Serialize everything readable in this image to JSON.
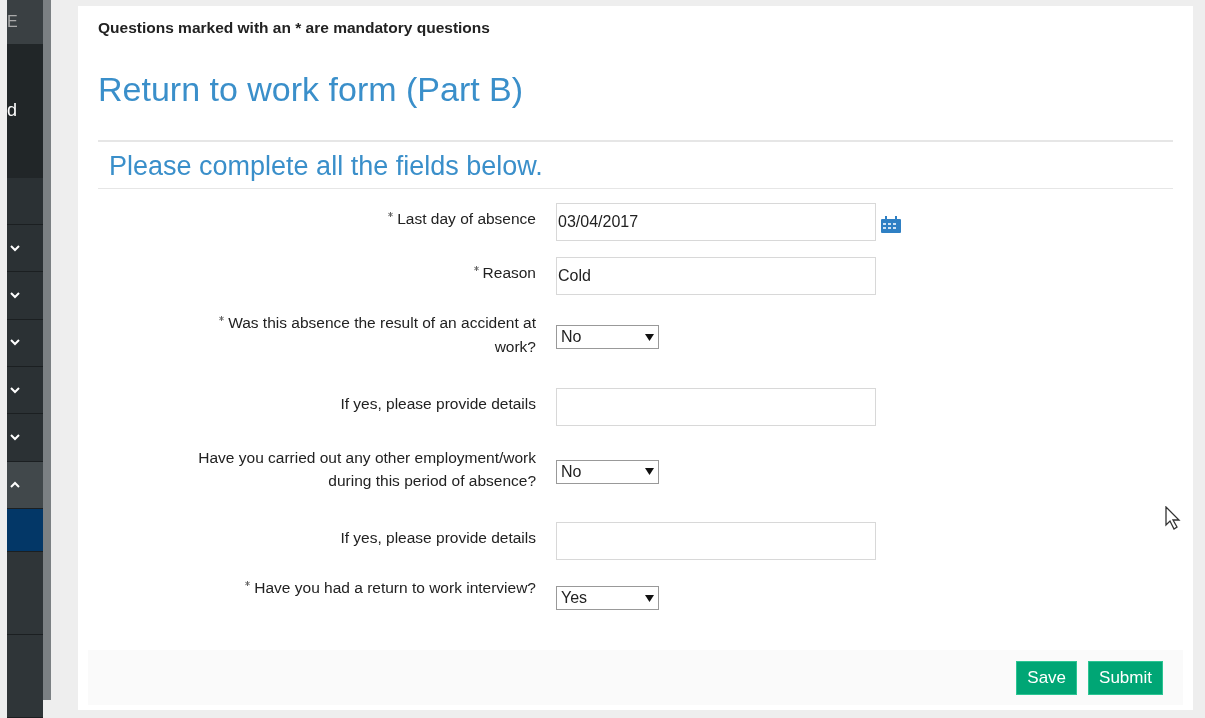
{
  "sidebar": {
    "header": "E",
    "title": "d",
    "items": [
      {
        "kind": "plain",
        "selected": false
      },
      {
        "kind": "group",
        "expanded": false,
        "selected": false
      },
      {
        "kind": "group",
        "expanded": false,
        "selected": false
      },
      {
        "kind": "group",
        "expanded": false,
        "selected": false
      },
      {
        "kind": "group",
        "expanded": false,
        "selected": false
      },
      {
        "kind": "group",
        "expanded": false,
        "selected": false
      },
      {
        "kind": "group",
        "expanded": true,
        "selected": false
      },
      {
        "kind": "plain",
        "selected": true
      },
      {
        "kind": "plain",
        "selected": false
      },
      {
        "kind": "plain",
        "selected": false
      }
    ]
  },
  "notice": "Questions marked with an * are mandatory questions",
  "title": "Return to work form (Part B)",
  "subtitle": "Please complete all the fields below.",
  "fields": [
    {
      "kind": "date",
      "required": true,
      "label": "Last day of absence",
      "value": "03/04/2017"
    },
    {
      "kind": "text",
      "required": true,
      "label": "Reason",
      "value": "Cold"
    },
    {
      "kind": "select",
      "required": true,
      "label": "Was this absence the result of an accident at work?",
      "value": "No"
    },
    {
      "kind": "text",
      "required": false,
      "label": "If yes, please provide details"
    },
    {
      "kind": "select",
      "required": false,
      "label": "Have you carried out any other employment/work during this period of absence?",
      "value": "No"
    },
    {
      "kind": "text",
      "required": false,
      "label": "If yes, please provide details"
    },
    {
      "kind": "select",
      "required": true,
      "label": "Have you had a return to work interview?",
      "value": "Yes"
    }
  ],
  "buttons": [
    "Save",
    "Submit"
  ]
}
